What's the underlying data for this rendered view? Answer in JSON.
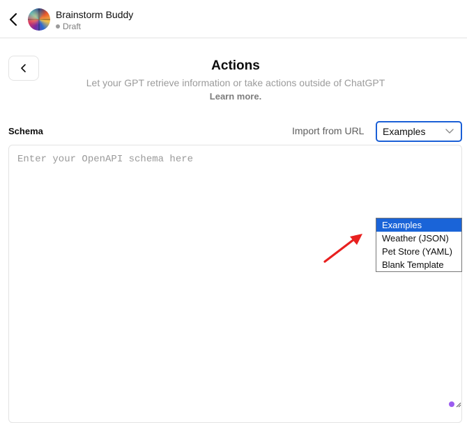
{
  "header": {
    "gpt_name": "Brainstorm Buddy",
    "status": "Draft",
    "back_icon": "chevron-left-icon",
    "avatar": "gpt-avatar-image"
  },
  "actions": {
    "title": "Actions",
    "subtitle": "Let your GPT retrieve information or take actions outside of ChatGPT",
    "learn_more": "Learn more."
  },
  "schema": {
    "label": "Schema",
    "import_from_url": "Import from URL",
    "select_value": "Examples",
    "placeholder": "Enter your OpenAPI schema here",
    "dropdown_options": [
      {
        "label": "Examples",
        "selected": true
      },
      {
        "label": "Weather (JSON)",
        "selected": false
      },
      {
        "label": "Pet Store (YAML)",
        "selected": false
      },
      {
        "label": "Blank Template",
        "selected": false
      }
    ]
  },
  "colors": {
    "accent_blue": "#1a64d8",
    "annotation_arrow": "#e8201f",
    "indicator_purple": "#9b5cf0"
  }
}
